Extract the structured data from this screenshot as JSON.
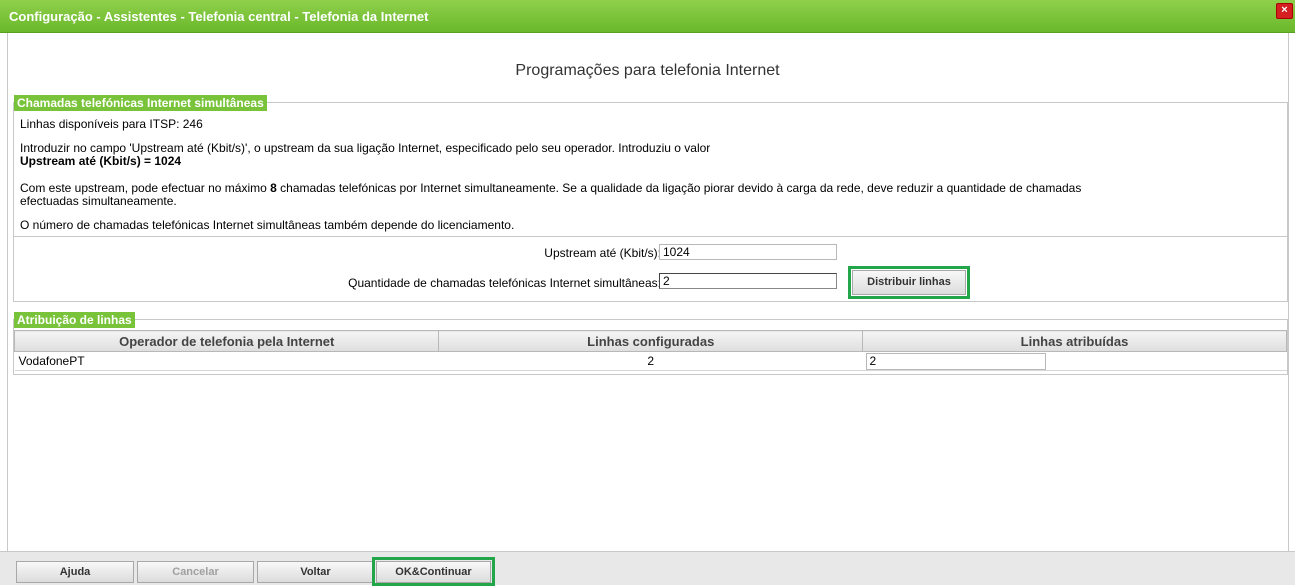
{
  "window": {
    "title": "Configuração - Assistentes - Telefonia central - Telefonia da Internet",
    "close": "×"
  },
  "page": {
    "heading": "Programações para telefonia Internet"
  },
  "simultaneous": {
    "legend": "Chamadas telefónicas Internet simultâneas",
    "lines_available": "Linhas disponíveis para ITSP: 246",
    "intro": "Introduzir no campo 'Upstream até (Kbit/s)', o upstream da sua ligação Internet, especificado pelo seu operador. Introduziu o valor",
    "upstream_value_text": "Upstream até (Kbit/s) = 1024",
    "max_calls_pre": "Com este upstream, pode efectuar no máximo ",
    "max_calls_number": "8",
    "max_calls_post": " chamadas telefónicas por Internet simultaneamente. Se a qualidade da ligação piorar devido à carga da rede, deve reduzir a quantidade de chamadas",
    "max_calls_line2": "efectuadas simultaneamente.",
    "licensing_note": "O número de chamadas telefónicas Internet simultâneas também depende do licenciamento.",
    "upstream_label": "Upstream até (Kbit/s):",
    "upstream_input": "1024",
    "calls_label": "Quantidade de chamadas telefónicas Internet simultâneas:",
    "calls_input": "2",
    "distribute_button": "Distribuir linhas"
  },
  "assignment": {
    "legend": "Atribuição de linhas",
    "columns": [
      "Operador de telefonia pela Internet",
      "Linhas configuradas",
      "Linhas atribuídas"
    ],
    "rows": [
      {
        "provider": "VodafonePT",
        "configured": "2",
        "assigned": "2"
      }
    ]
  },
  "footer": {
    "help": "Ajuda",
    "cancel": "Cancelar",
    "back": "Voltar",
    "ok_continue": "OK&Continuar"
  },
  "colors": {
    "titlebar": "#6ab82c",
    "legend": "#79c33a",
    "highlight": "#23a64a"
  }
}
